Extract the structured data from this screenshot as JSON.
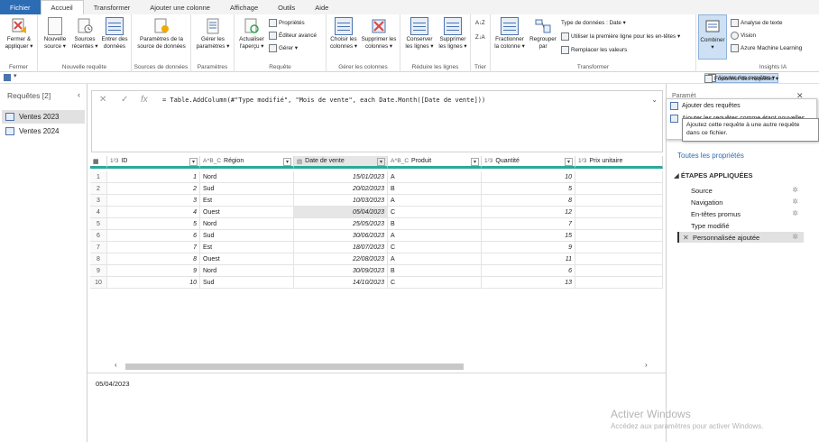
{
  "tabs": [
    "Fichier",
    "Accueil",
    "Transformer",
    "Ajouter une colonne",
    "Affichage",
    "Outils",
    "Aide"
  ],
  "ribbon": {
    "groups": {
      "fermer": "Fermer",
      "nouvelle_requete": "Nouvelle requête",
      "sources": "Sources de données",
      "parametres": "Paramètres",
      "requete": "Requête",
      "gerer_colonnes": "Gérer les colonnes",
      "reduire": "Réduire les lignes",
      "trier": "Trier",
      "transformer": "Transformer",
      "insights": "Insights IA"
    },
    "buttons": {
      "fermer_l1": "Fermer &",
      "fermer_l2": "appliquer ▾",
      "nouvelle_l1": "Nouvelle",
      "nouvelle_l2": "source ▾",
      "sources_l1": "Sources",
      "sources_l2": "récentes ▾",
      "entrer_l1": "Entrer des",
      "entrer_l2": "données",
      "param_src_l1": "Paramètres de la",
      "param_src_l2": "source de données",
      "gerer_param_l1": "Gérer les",
      "gerer_param_l2": "paramètres ▾",
      "actualiser_l1": "Actualiser",
      "actualiser_l2": "l'aperçu ▾",
      "proprietes": "Propriétés",
      "editeur": "Éditeur avancé",
      "gerer": "Gérer ▾",
      "choisir_l1": "Choisir les",
      "choisir_l2": "colonnes ▾",
      "supprimer_col_l1": "Supprimer les",
      "supprimer_col_l2": "colonnes ▾",
      "conserver_l1": "Conserver",
      "conserver_l2": "les lignes ▾",
      "supprimer_lig_l1": "Supprimer",
      "supprimer_lig_l2": "les lignes ▾",
      "sort_asc": "A↓Z",
      "sort_desc": "Z↓A",
      "fractionner_l1": "Fractionner",
      "fractionner_l2": "la colonne ▾",
      "regrouper_l1": "Regrouper",
      "regrouper_l2": "par",
      "type_donnees": "Type de données : Date ▾",
      "premiere_ligne": "Utiliser la première ligne pour les en-têtes ▾",
      "remplacer": "Remplacer les valeurs",
      "combiner": "Combiner",
      "analyse_texte": "Analyse de texte",
      "vision": "Vision",
      "azure_ml": "Azure Machine Learning"
    },
    "combine_menu": {
      "fusionner": "Fusionner des requêtes ▾",
      "ajouter": "Ajouter des requêtes ▾"
    }
  },
  "queries_pane": {
    "title": "Requêtes [2]",
    "items": [
      "Ventes 2023",
      "Ventes 2024"
    ]
  },
  "formula": {
    "code": "= Table.AddColumn(#\"Type modifié\", \"Mois de vente\", each Date.Month([Date de vente]))"
  },
  "table": {
    "columns": [
      {
        "type": "1²3",
        "name": "ID"
      },
      {
        "type": "A^B_C",
        "name": "Région"
      },
      {
        "type": "",
        "name": "Date de vente"
      },
      {
        "type": "A^B_C",
        "name": "Produit"
      },
      {
        "type": "1²3",
        "name": "Quantité"
      },
      {
        "type": "1²3",
        "name": "Prix unitaire"
      }
    ],
    "rows": [
      [
        "1",
        "1",
        "Nord",
        "15/01/2023",
        "A",
        "10"
      ],
      [
        "2",
        "2",
        "Sud",
        "20/02/2023",
        "B",
        "5"
      ],
      [
        "3",
        "3",
        "Est",
        "10/03/2023",
        "A",
        "8"
      ],
      [
        "4",
        "4",
        "Ouest",
        "05/04/2023",
        "C",
        "12"
      ],
      [
        "5",
        "5",
        "Nord",
        "25/05/2023",
        "B",
        "7"
      ],
      [
        "6",
        "6",
        "Sud",
        "30/06/2023",
        "A",
        "15"
      ],
      [
        "7",
        "7",
        "Est",
        "18/07/2023",
        "C",
        "9"
      ],
      [
        "8",
        "8",
        "Ouest",
        "22/08/2023",
        "A",
        "11"
      ],
      [
        "9",
        "9",
        "Nord",
        "30/09/2023",
        "B",
        "6"
      ],
      [
        "10",
        "10",
        "Sud",
        "14/10/2023",
        "C",
        "13"
      ]
    ]
  },
  "status_value": "05/04/2023",
  "right_pane": {
    "params_label": "Paramèt",
    "all_properties": "Toutes les propriétés",
    "steps_title": "ÉTAPES APPLIQUÉES",
    "steps": [
      "Source",
      "Navigation",
      "En-têtes promus",
      "Type modifié",
      "Personnalisée ajoutée"
    ]
  },
  "dropdown": {
    "item1": "Ajouter des requêtes",
    "item2": "Ajouter les requêtes comme étant nouvelles"
  },
  "tooltip": "Ajoutez cette requête à une autre requête dans ce fichier.",
  "watermark": {
    "line1": "Activer Windows",
    "line2": "Accédez aux paramètres pour activer Windows."
  }
}
